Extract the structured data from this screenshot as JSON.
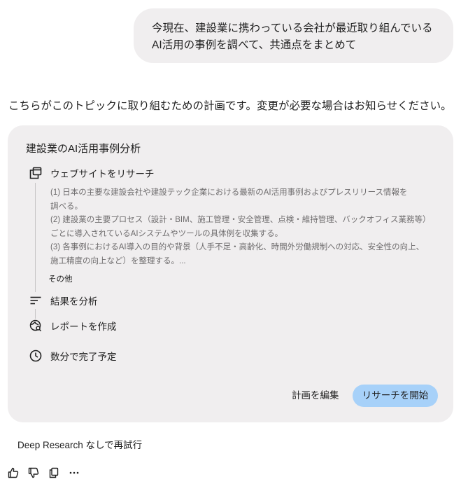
{
  "user_message": {
    "lines": [
      "今現在、建設業に携わっている会社が最近取り組んでいる",
      "AI活用の事例を調べて、共通点をまとめて"
    ]
  },
  "response": {
    "intro": "こちらがこのトピックに取り組むための計画です。変更が必要な場合はお知らせください。"
  },
  "plan": {
    "title": "建設業のAI活用事例分析",
    "steps": [
      {
        "label": "ウェブサイトをリサーチ",
        "icon": "web-research-icon"
      },
      {
        "label": "結果を分析",
        "icon": "analyze-list-icon"
      },
      {
        "label": "レポートを作成",
        "icon": "report-globe-icon"
      },
      {
        "label": "数分で完了予定",
        "icon": "clock-icon"
      }
    ],
    "details": [
      "(1) 日本の主要な建設会社や建設テック企業における最新のAI活用事例およびプレスリリース情報を",
      "調べる。",
      "(2) 建設業の主要プロセス（設計・BIM、施工管理・安全管理、点検・維持管理、バックオフィス業務等）",
      "ごとに導入されているAIシステムやツールの具体例を収集する。",
      "(3) 各事例におけるAI導入の目的や背景（人手不足・高齢化、時間外労働規制への対応、安全性の向上、",
      "施工精度の向上など）を整理する。..."
    ],
    "more_label": "その他",
    "edit_label": "計画を編集",
    "start_label": "リサーチを開始"
  },
  "footer": {
    "retry_label": "Deep Research なしで再試行",
    "actions": [
      "thumbs-up-icon",
      "thumbs-down-icon",
      "copy-icon",
      "more-icon"
    ]
  },
  "colors": {
    "bubble_bg": "#f0eeef",
    "card_bg": "#f0eeef",
    "start_button_bg": "#a7d1f9",
    "detail_text": "#6e6c6d"
  }
}
